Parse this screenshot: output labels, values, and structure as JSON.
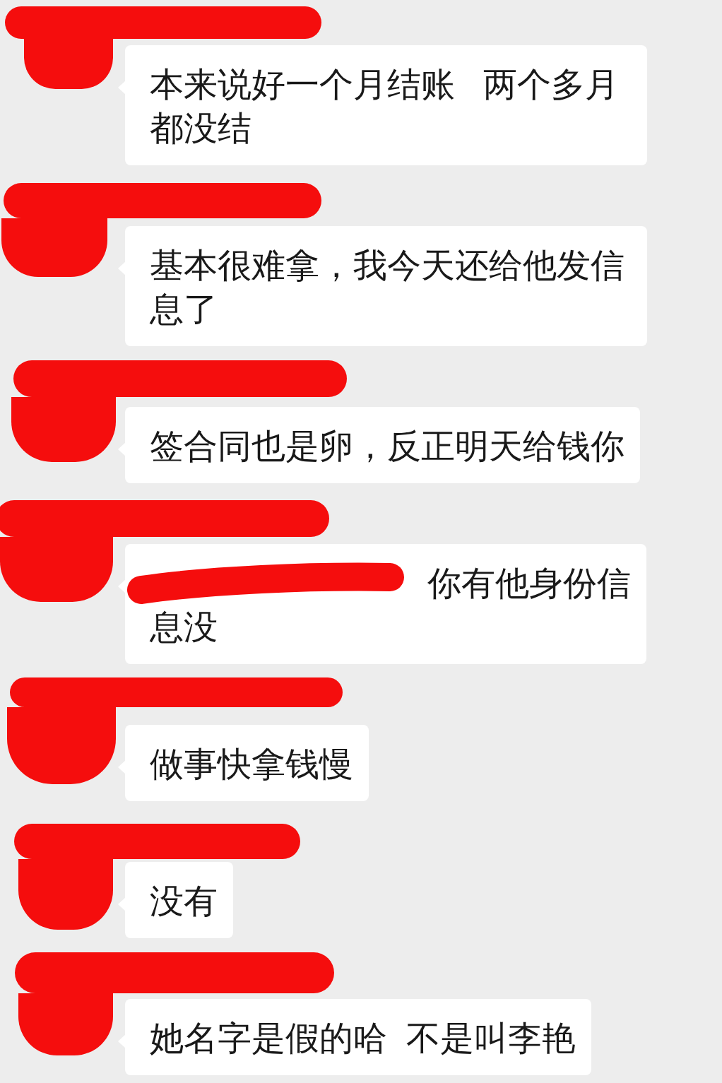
{
  "chat": {
    "messages": [
      {
        "kind": "text",
        "text": "本来说好一个月结账   两个多月都没结"
      },
      {
        "kind": "text",
        "text": "基本很难拿，我今天还给他发信息了"
      },
      {
        "kind": "text",
        "text": "签合同也是卵，反正明天给钱你"
      },
      {
        "kind": "partly_hidden",
        "visible_lines": [
          "你有他身份信",
          "息没"
        ]
      },
      {
        "kind": "text",
        "text": "做事快拿钱慢"
      },
      {
        "kind": "text",
        "text": "没有"
      },
      {
        "kind": "text",
        "text": "她名字是假的哈  不是叫李艳"
      }
    ]
  }
}
